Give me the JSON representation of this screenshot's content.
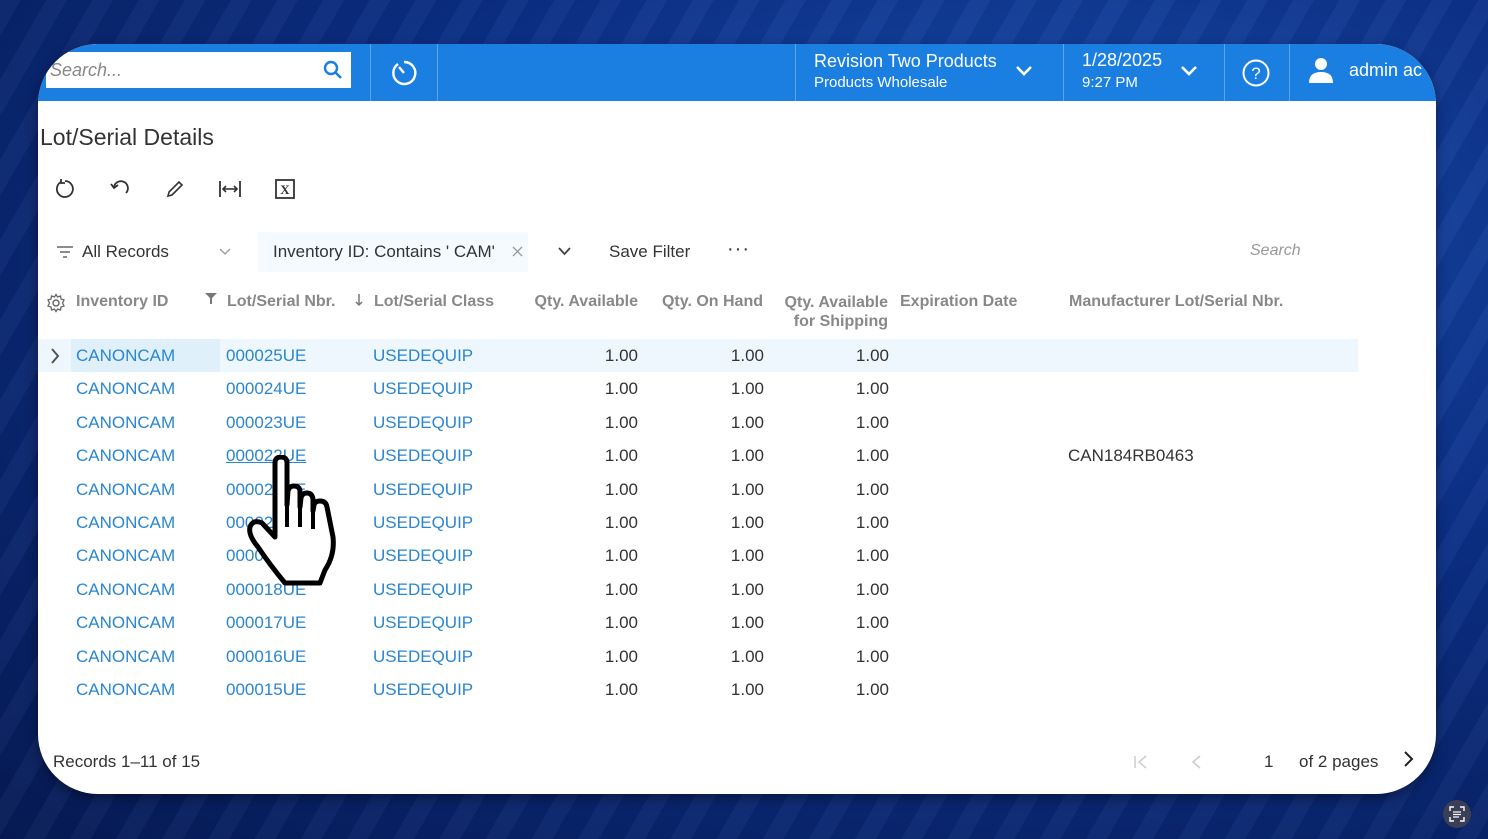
{
  "topbar": {
    "search_placeholder": "Search...",
    "company_name": "Revision Two Products",
    "branch_name": "Products Wholesale",
    "date": "1/28/2025",
    "time": "9:27 PM",
    "user_name": "admin ac",
    "brand_color": "#1a7fe0"
  },
  "page": {
    "title": "Lot/Serial Details"
  },
  "toolbar": {
    "refresh": "refresh-icon",
    "undo": "undo-icon",
    "edit": "pencil-icon",
    "fit_columns": "fit-columns-icon",
    "export_excel": "excel-icon"
  },
  "filterbar": {
    "filter_label": "All Records",
    "active_filter": "Inventory ID: Contains ' CAM'",
    "save_filter": "Save Filter",
    "more": "···",
    "search_placeholder": "Search"
  },
  "grid": {
    "columns": [
      "Inventory ID",
      "Lot/Serial Nbr.",
      "Lot/Serial Class",
      "Qty. Available",
      "Qty. On Hand",
      "Qty. Available",
      "for Shipping",
      "Expiration Date",
      "Manufacturer Lot/Serial Nbr."
    ],
    "rows": [
      {
        "inv": "CANONCAM",
        "lot": "000025UE",
        "cls": "USEDEQUIP",
        "avail": "1.00",
        "onhand": "1.00",
        "ship": "1.00",
        "exp": "",
        "mfr": ""
      },
      {
        "inv": "CANONCAM",
        "lot": "000024UE",
        "cls": "USEDEQUIP",
        "avail": "1.00",
        "onhand": "1.00",
        "ship": "1.00",
        "exp": "",
        "mfr": ""
      },
      {
        "inv": "CANONCAM",
        "lot": "000023UE",
        "cls": "USEDEQUIP",
        "avail": "1.00",
        "onhand": "1.00",
        "ship": "1.00",
        "exp": "",
        "mfr": ""
      },
      {
        "inv": "CANONCAM",
        "lot": "000022UE",
        "cls": "USEDEQUIP",
        "avail": "1.00",
        "onhand": "1.00",
        "ship": "1.00",
        "exp": "",
        "mfr": "CAN184RB0463"
      },
      {
        "inv": "CANONCAM",
        "lot": "000021UE",
        "cls": "USEDEQUIP",
        "avail": "1.00",
        "onhand": "1.00",
        "ship": "1.00",
        "exp": "",
        "mfr": ""
      },
      {
        "inv": "CANONCAM",
        "lot": "000020UE",
        "cls": "USEDEQUIP",
        "avail": "1.00",
        "onhand": "1.00",
        "ship": "1.00",
        "exp": "",
        "mfr": ""
      },
      {
        "inv": "CANONCAM",
        "lot": "000019UE",
        "cls": "USEDEQUIP",
        "avail": "1.00",
        "onhand": "1.00",
        "ship": "1.00",
        "exp": "",
        "mfr": ""
      },
      {
        "inv": "CANONCAM",
        "lot": "000018UE",
        "cls": "USEDEQUIP",
        "avail": "1.00",
        "onhand": "1.00",
        "ship": "1.00",
        "exp": "",
        "mfr": ""
      },
      {
        "inv": "CANONCAM",
        "lot": "000017UE",
        "cls": "USEDEQUIP",
        "avail": "1.00",
        "onhand": "1.00",
        "ship": "1.00",
        "exp": "",
        "mfr": ""
      },
      {
        "inv": "CANONCAM",
        "lot": "000016UE",
        "cls": "USEDEQUIP",
        "avail": "1.00",
        "onhand": "1.00",
        "ship": "1.00",
        "exp": "",
        "mfr": ""
      },
      {
        "inv": "CANONCAM",
        "lot": "000015UE",
        "cls": "USEDEQUIP",
        "avail": "1.00",
        "onhand": "1.00",
        "ship": "1.00",
        "exp": "",
        "mfr": ""
      }
    ]
  },
  "footer": {
    "records": "Records 1–11 of 15",
    "current_page": "1",
    "page_total": "of 2 pages"
  }
}
